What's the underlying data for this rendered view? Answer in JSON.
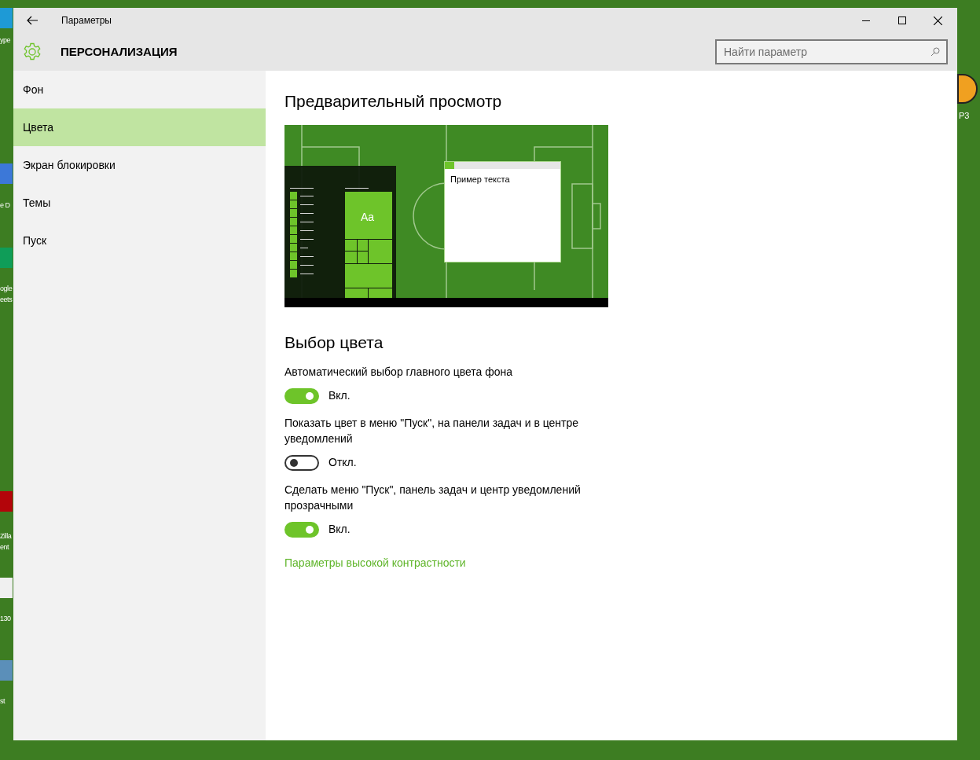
{
  "desktop": {
    "left_labels": [
      {
        "lines": [
          "ype"
        ]
      },
      {
        "lines": [
          "e D"
        ]
      },
      {
        "lines": [
          "ogle",
          "eets"
        ]
      },
      {
        "lines": [
          "Zilla",
          "ent"
        ]
      },
      {
        "lines": [
          "130"
        ]
      },
      {
        "lines": [
          "st"
        ]
      }
    ],
    "right_labels": [
      {
        "lines": [
          "P3"
        ]
      }
    ]
  },
  "window": {
    "title": "Параметры",
    "header": "ПЕРСОНАЛИЗАЦИЯ",
    "search": {
      "placeholder": "Найти параметр"
    }
  },
  "sidebar": {
    "items": [
      {
        "label": "Фон",
        "selected": false
      },
      {
        "label": "Цвета",
        "selected": true
      },
      {
        "label": "Экран блокировки",
        "selected": false
      },
      {
        "label": "Темы",
        "selected": false
      },
      {
        "label": "Пуск",
        "selected": false
      }
    ]
  },
  "preview": {
    "title": "Предварительный просмотр",
    "tile_label": "Aa",
    "sample_text": "Пример текста"
  },
  "colors": {
    "title": "Выбор цвета",
    "settings": [
      {
        "label": "Автоматический выбор главного цвета фона",
        "on": true,
        "state_text": "Вкл."
      },
      {
        "label": "Показать цвет в меню \"Пуск\", на панели задач и в центре уведомлений",
        "on": false,
        "state_text": "Откл."
      },
      {
        "label": "Сделать меню \"Пуск\", панель задач и центр уведомлений прозрачными",
        "on": true,
        "state_text": "Вкл."
      }
    ],
    "link": "Параметры высокой контрастности"
  }
}
